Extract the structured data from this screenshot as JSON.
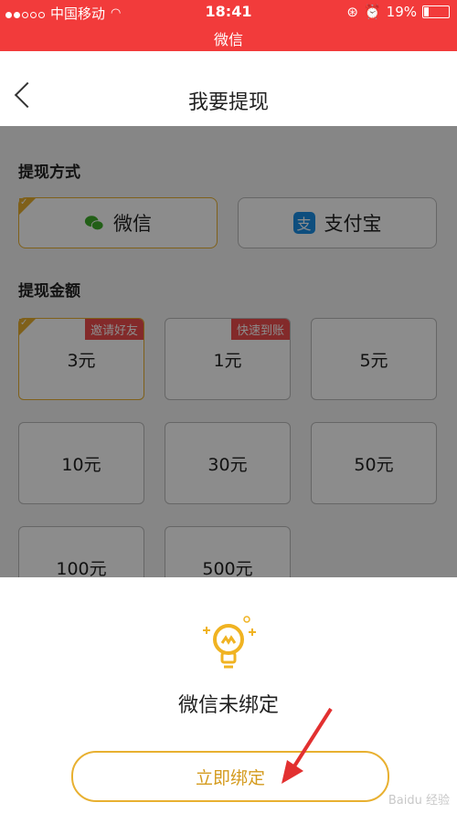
{
  "status": {
    "carrier": "中国移动",
    "time": "18:41",
    "battery": "19%",
    "subtitle": "微信"
  },
  "nav": {
    "title": "我要提现"
  },
  "methods": {
    "label": "提现方式",
    "items": [
      {
        "label": "微信",
        "selected": true
      },
      {
        "label": "支付宝",
        "selected": false
      }
    ]
  },
  "amounts": {
    "label": "提现金额",
    "items": [
      {
        "value": "3元",
        "badge": "邀请好友",
        "selected": true
      },
      {
        "value": "1元",
        "badge": "快速到账",
        "selected": false
      },
      {
        "value": "5元",
        "badge": "",
        "selected": false
      },
      {
        "value": "10元",
        "badge": "",
        "selected": false
      },
      {
        "value": "30元",
        "badge": "",
        "selected": false
      },
      {
        "value": "50元",
        "badge": "",
        "selected": false
      },
      {
        "value": "100元",
        "badge": "",
        "selected": false
      },
      {
        "value": "500元",
        "badge": "",
        "selected": false
      }
    ]
  },
  "sheet": {
    "title": "微信未绑定",
    "button": "立即绑定"
  },
  "watermark": "Baidu 经验"
}
